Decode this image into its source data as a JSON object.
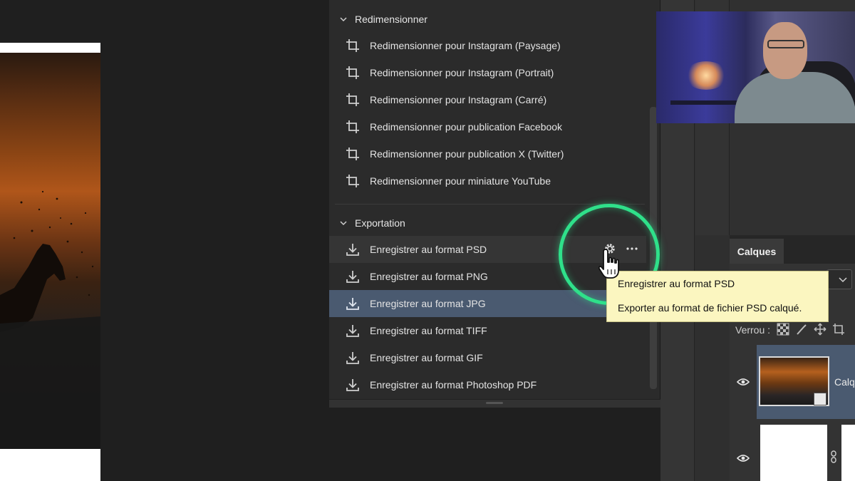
{
  "actions": {
    "groups": [
      {
        "title": "Redimensionner",
        "items": [
          {
            "label": "Redimensionner pour Instagram (Paysage)",
            "icon": "crop-icon"
          },
          {
            "label": "Redimensionner pour Instagram (Portrait)",
            "icon": "crop-icon"
          },
          {
            "label": "Redimensionner pour Instagram (Carré)",
            "icon": "crop-icon"
          },
          {
            "label": "Redimensionner pour publication Facebook",
            "icon": "crop-icon"
          },
          {
            "label": "Redimensionner pour publication X (Twitter)",
            "icon": "crop-icon"
          },
          {
            "label": "Redimensionner pour miniature YouTube",
            "icon": "crop-icon"
          }
        ]
      },
      {
        "title": "Exportation",
        "items": [
          {
            "label": "Enregistrer au format PSD",
            "icon": "download-icon",
            "state": "hover"
          },
          {
            "label": "Enregistrer au format PNG",
            "icon": "download-icon"
          },
          {
            "label": "Enregistrer au format JPG",
            "icon": "download-icon",
            "state": "selected"
          },
          {
            "label": "Enregistrer au format TIFF",
            "icon": "download-icon"
          },
          {
            "label": "Enregistrer au format GIF",
            "icon": "download-icon"
          },
          {
            "label": "Enregistrer au format Photoshop PDF",
            "icon": "download-icon"
          }
        ]
      }
    ],
    "item_tools": [
      "gear-icon",
      "more-icon"
    ]
  },
  "tooltip": {
    "title": "Enregistrer au format PSD",
    "description": "Exporter au format de fichier PSD calqué."
  },
  "layers": {
    "tab": "Calques",
    "lock_label": "Verrou :",
    "layer_name": "Calq"
  },
  "colors": {
    "highlight_ring": "#2fe08a",
    "selected_row": "#4a5a70",
    "tooltip_bg": "#fbf6c0"
  }
}
